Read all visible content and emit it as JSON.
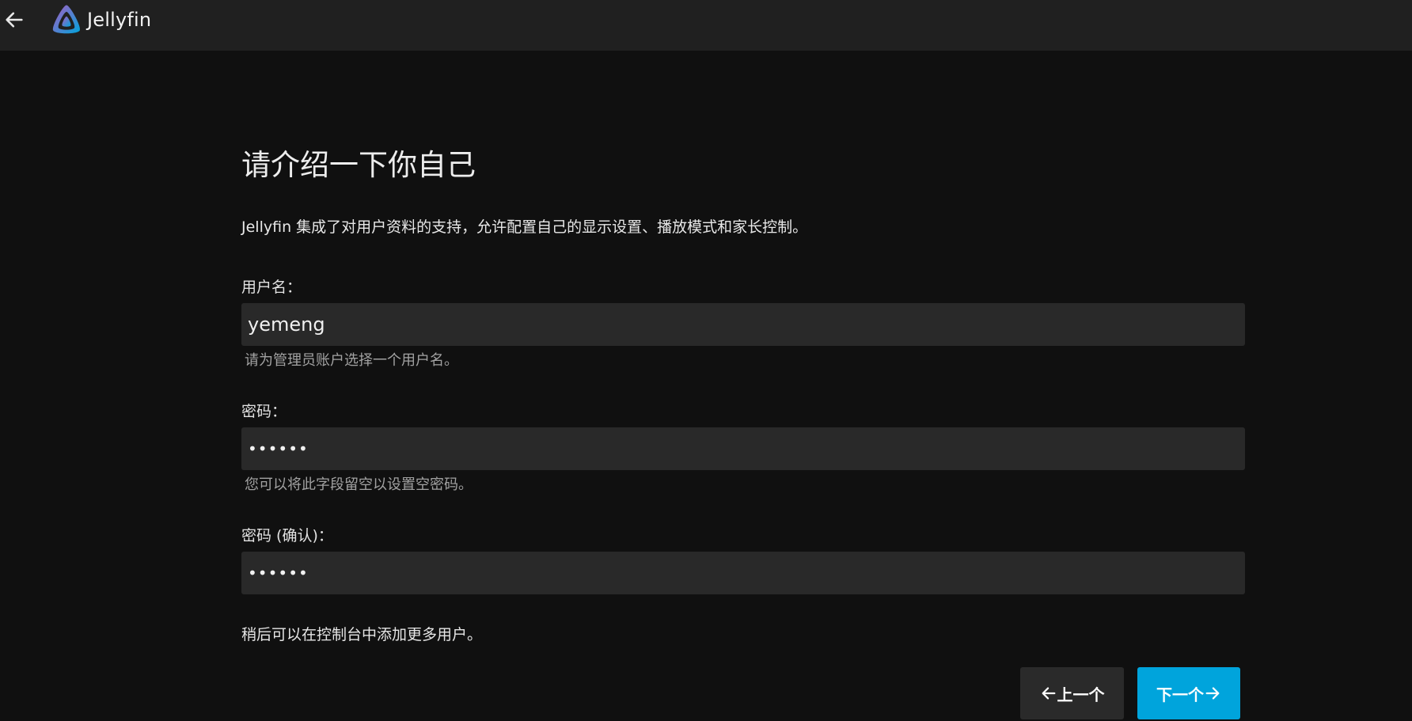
{
  "header": {
    "back_icon": "arrow-left-icon",
    "app_name": "Jellyfin",
    "logo_colors": [
      "#aa5cc3",
      "#00a4dc"
    ]
  },
  "main": {
    "title": "请介绍一下你自己",
    "intro": "Jellyfin 集成了对用户资料的支持，允许配置自己的显示设置、播放模式和家长控制。",
    "username": {
      "label": "用户名：",
      "value": "yemeng",
      "help": "请为管理员账户选择一个用户名。"
    },
    "password": {
      "label": "密码：",
      "value": "••••••",
      "help": "您可以将此字段留空以设置空密码。"
    },
    "password_confirm": {
      "label": "密码 (确认)：",
      "value": "••••••"
    },
    "footer_note": "稍后可以在控制台中添加更多用户。"
  },
  "buttons": {
    "prev_label": "上一个",
    "next_label": "下一个",
    "prev_icon": "arrow-left-icon",
    "next_icon": "arrow-right-icon"
  },
  "colors": {
    "accent": "#00a4dc",
    "background": "#101010",
    "header": "#202020",
    "input": "#292929"
  }
}
